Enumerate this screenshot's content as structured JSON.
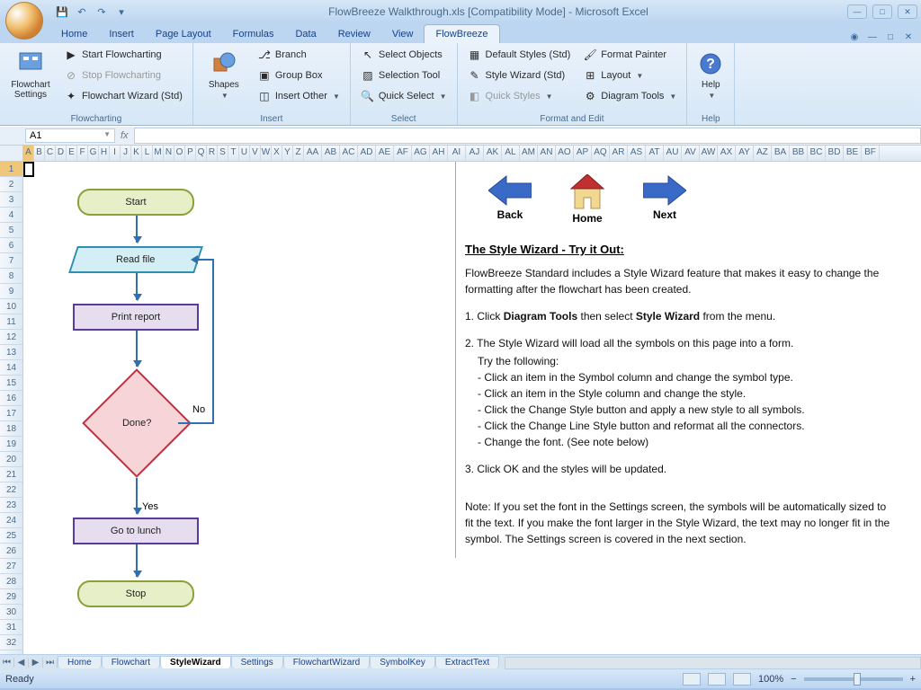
{
  "title": "FlowBreeze Walkthrough.xls  [Compatibility Mode] - Microsoft Excel",
  "qat": {
    "save": "💾",
    "undo": "↶",
    "redo": "↷"
  },
  "tabs": [
    "Home",
    "Insert",
    "Page Layout",
    "Formulas",
    "Data",
    "Review",
    "View",
    "FlowBreeze"
  ],
  "active_tab": "FlowBreeze",
  "ribbon": {
    "flowcharting": {
      "label": "Flowcharting",
      "big": "Flowchart\nSettings",
      "items": [
        "Start Flowcharting",
        "Stop Flowcharting",
        "Flowchart Wizard (Std)"
      ]
    },
    "insert": {
      "label": "Insert",
      "big": "Shapes",
      "items": [
        "Branch",
        "Group Box",
        "Insert Other"
      ]
    },
    "select": {
      "label": "Select",
      "items": [
        "Select Objects",
        "Selection Tool",
        "Quick Select"
      ]
    },
    "format": {
      "label": "Format and Edit",
      "col1": [
        "Default Styles (Std)",
        "Style Wizard (Std)",
        "Quick Styles"
      ],
      "col2": [
        "Format Painter",
        "Layout",
        "Diagram Tools"
      ]
    },
    "help": {
      "label": "Help",
      "big": "Help"
    }
  },
  "name_box": "A1",
  "fx": "fx",
  "columns": [
    "A",
    "B",
    "C",
    "D",
    "E",
    "F",
    "G",
    "H",
    "I",
    "J",
    "K",
    "L",
    "M",
    "N",
    "O",
    "P",
    "Q",
    "R",
    "S",
    "T",
    "U",
    "V",
    "W",
    "X",
    "Y",
    "Z",
    "AA",
    "AB",
    "AC",
    "AD",
    "AE",
    "AF",
    "AG",
    "AH",
    "AI",
    "AJ",
    "AK",
    "AL",
    "AM",
    "AN",
    "AO",
    "AP",
    "AQ",
    "AR",
    "AS",
    "AT",
    "AU",
    "AV",
    "AW",
    "AX",
    "AY",
    "AZ",
    "BA",
    "BB",
    "BC",
    "BD",
    "BE",
    "BF"
  ],
  "rows": 32,
  "flowchart": {
    "start": "Start",
    "read": "Read file",
    "print": "Print report",
    "done": "Done?",
    "no": "No",
    "yes": "Yes",
    "lunch": "Go to lunch",
    "stop": "Stop"
  },
  "nav": {
    "back": "Back",
    "home": "Home",
    "next": "Next"
  },
  "instr": {
    "title": "The Style Wizard - Try it Out:",
    "p1": "FlowBreeze Standard includes a Style Wizard feature that makes it easy to change the formatting after the flowchart has been created.",
    "li1a": "1. Click ",
    "li1b": "Diagram Tools",
    "li1c": " then select ",
    "li1d": "Style Wizard",
    "li1e": " from the menu.",
    "li2": "2. The Style Wizard will load all the symbols on this page into a form.",
    "li2a": "Try the following:",
    "b1": "- Click an item in the Symbol column and change the symbol type.",
    "b2": "- Click an item in the Style column and change the style.",
    "b3": "- Click the Change Style button and apply a new style to all symbols.",
    "b4": "- Click the Change Line Style button and reformat all the connectors.",
    "b5": "- Change the font. (See note below)",
    "li3": "3. Click OK and the styles will be updated.",
    "note": "Note: If you set the font in the Settings screen, the symbols will be automatically sized to fit the text. If you make the font larger in the Style Wizard, the text may no longer fit in the symbol. The Settings screen is covered in the next section."
  },
  "sheet_tabs": [
    "Home",
    "Flowchart",
    "StyleWizard",
    "Settings",
    "FlowchartWizard",
    "SymbolKey",
    "ExtractText"
  ],
  "active_sheet": "StyleWizard",
  "status": "Ready",
  "zoom": "100%"
}
